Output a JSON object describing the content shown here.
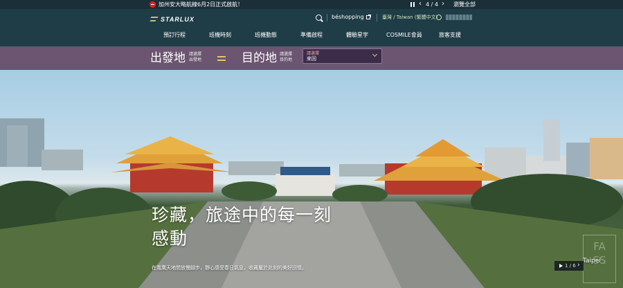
{
  "announcement": {
    "text": "加州安大略航線6月2日正式啟航！",
    "counter": "4 / 4",
    "view_all": "瀏覽全部"
  },
  "header": {
    "logo_text": "STARLUX",
    "shopping_label": "béshopping",
    "language": "臺灣 / Taiwan (繁體中文)"
  },
  "nav": {
    "items": [
      "預訂行程",
      "班機時刻",
      "班機動態",
      "準備啟程",
      "體驗星宇",
      "COSMILE會員",
      "旅客支援"
    ]
  },
  "booking": {
    "origin_label": "出發地",
    "origin_hint_1": "請選擇",
    "origin_hint_2": "出發地",
    "dest_label": "目的地",
    "dest_hint_1": "請選擇",
    "dest_hint_2": "目的地",
    "trip_hint": "請選擇",
    "trip_value": "來回"
  },
  "hero": {
    "title_line1": "珍藏，旅途中的每一刻",
    "title_line2": "感動",
    "subtitle": "在寬廣天地間放慢腳步，靜心感受春日氣息，收藏屬於此刻的美好回憶。",
    "slide_counter": "1 / 6",
    "location": "Taipei"
  },
  "colors": {
    "header_bg": "#1f3d47",
    "booking_bg": "#6b5570",
    "accent_gold": "#e8c46b"
  }
}
